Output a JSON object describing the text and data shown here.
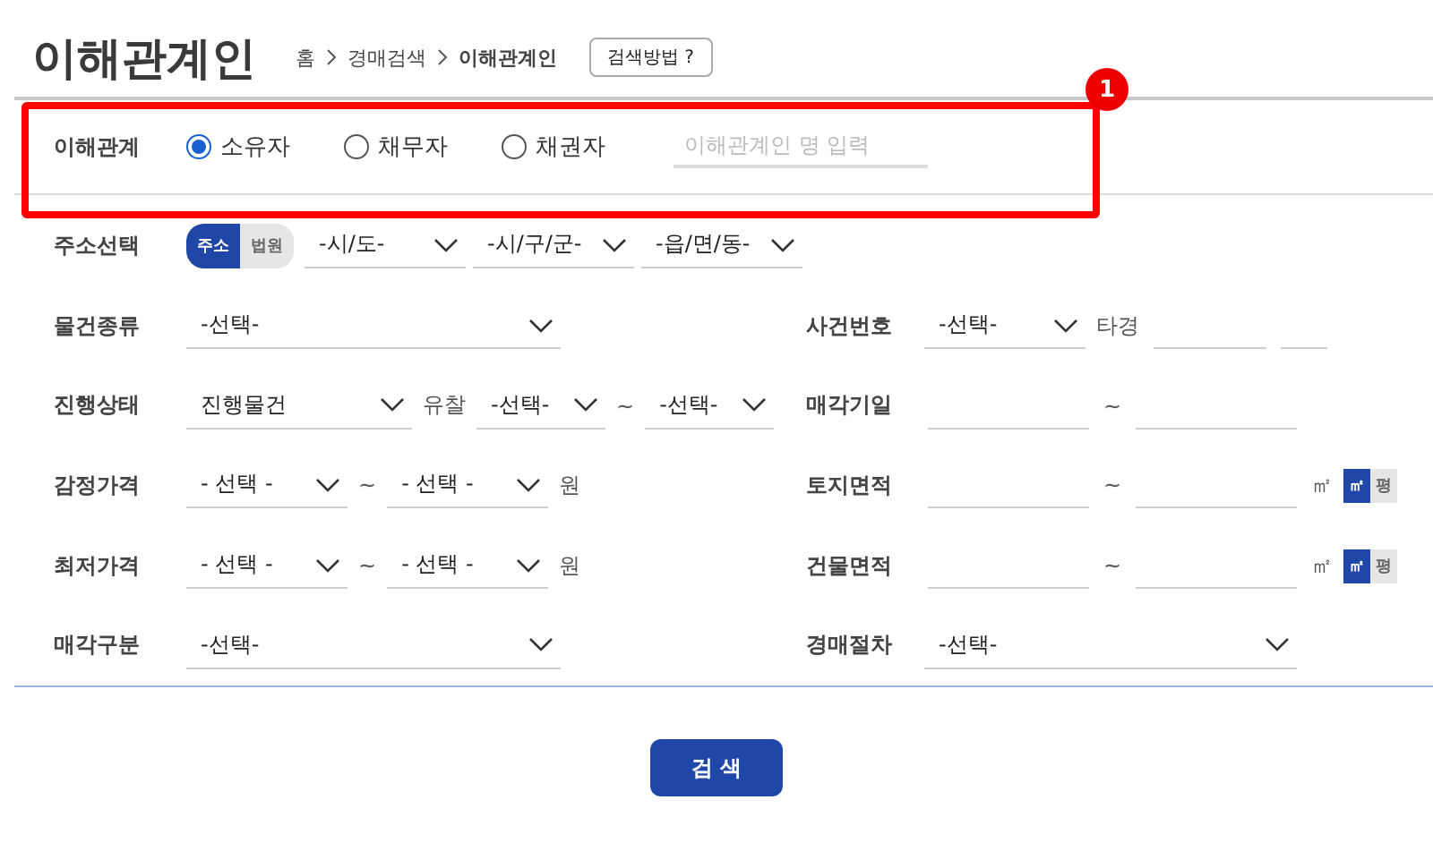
{
  "title": "이해관계인",
  "breadcrumb": [
    {
      "label": "홈",
      "selected": false
    },
    {
      "label": "경매검색",
      "selected": false
    },
    {
      "label": "이해관계인",
      "selected": true
    }
  ],
  "help_button": "검색방법 ?",
  "party": {
    "label": "이해관계",
    "options": [
      {
        "label": "소유자",
        "selected": true
      },
      {
        "label": "채무자",
        "selected": false
      },
      {
        "label": "채권자",
        "selected": false
      }
    ],
    "placeholder": "이해관계인 명 입력"
  },
  "annotation": {
    "number": "1"
  },
  "rows": [
    {
      "fields": [
        {
          "label": "주소선택",
          "controls": [
            {
              "kind": "toggle",
              "options": [
                {
                  "label": "주소",
                  "selected": true
                },
                {
                  "label": "법원",
                  "selected": false
                }
              ]
            },
            {
              "kind": "select",
              "value": "-시/도-"
            },
            {
              "kind": "select",
              "value": "-시/구/군-"
            },
            {
              "kind": "select",
              "value": "-읍/면/동-"
            }
          ]
        }
      ]
    },
    {
      "fields": [
        {
          "label": "물건종류",
          "controls": [
            {
              "kind": "select",
              "value": "-선택-"
            }
          ]
        },
        {
          "label": "사건번호",
          "controls": [
            {
              "kind": "select",
              "value": "-선택-"
            },
            {
              "kind": "text",
              "value": "타경"
            },
            {
              "kind": "input"
            },
            {
              "kind": "input"
            }
          ]
        }
      ]
    },
    {
      "fields": [
        {
          "label": "진행상태",
          "controls": [
            {
              "kind": "select",
              "value": "진행물건"
            },
            {
              "kind": "text",
              "value": "유찰"
            },
            {
              "kind": "select",
              "value": "-선택-"
            },
            {
              "kind": "text",
              "value": "~"
            },
            {
              "kind": "select",
              "value": "-선택-"
            }
          ]
        },
        {
          "label": "매각기일",
          "controls": [
            {
              "kind": "input"
            },
            {
              "kind": "text",
              "value": "~"
            },
            {
              "kind": "input"
            }
          ]
        }
      ]
    },
    {
      "fields": [
        {
          "label": "감정가격",
          "controls": [
            {
              "kind": "select",
              "value": "- 선택 -"
            },
            {
              "kind": "text",
              "value": "~"
            },
            {
              "kind": "select",
              "value": "- 선택 -"
            },
            {
              "kind": "text",
              "value": "원"
            }
          ]
        },
        {
          "label": "토지면적",
          "controls": [
            {
              "kind": "input"
            },
            {
              "kind": "text",
              "value": "~"
            },
            {
              "kind": "input"
            },
            {
              "kind": "text",
              "value": "㎡"
            },
            {
              "kind": "unit_toggle",
              "options": [
                {
                  "label": "㎡",
                  "selected": true
                },
                {
                  "label": "평",
                  "selected": false
                }
              ]
            }
          ]
        }
      ]
    },
    {
      "fields": [
        {
          "label": "최저가격",
          "controls": [
            {
              "kind": "select",
              "value": "- 선택 -"
            },
            {
              "kind": "text",
              "value": "~"
            },
            {
              "kind": "select",
              "value": "- 선택 -"
            },
            {
              "kind": "text",
              "value": "원"
            }
          ]
        },
        {
          "label": "건물면적",
          "controls": [
            {
              "kind": "input"
            },
            {
              "kind": "text",
              "value": "~"
            },
            {
              "kind": "input"
            },
            {
              "kind": "text",
              "value": "㎡"
            },
            {
              "kind": "unit_toggle",
              "options": [
                {
                  "label": "㎡",
                  "selected": true
                },
                {
                  "label": "평",
                  "selected": false
                }
              ]
            }
          ]
        }
      ]
    },
    {
      "fields": [
        {
          "label": "매각구분",
          "controls": [
            {
              "kind": "select",
              "value": "-선택-"
            }
          ]
        },
        {
          "label": "경매절차",
          "controls": [
            {
              "kind": "select",
              "value": "-선택-"
            }
          ]
        }
      ]
    }
  ],
  "search_button": "검 색"
}
